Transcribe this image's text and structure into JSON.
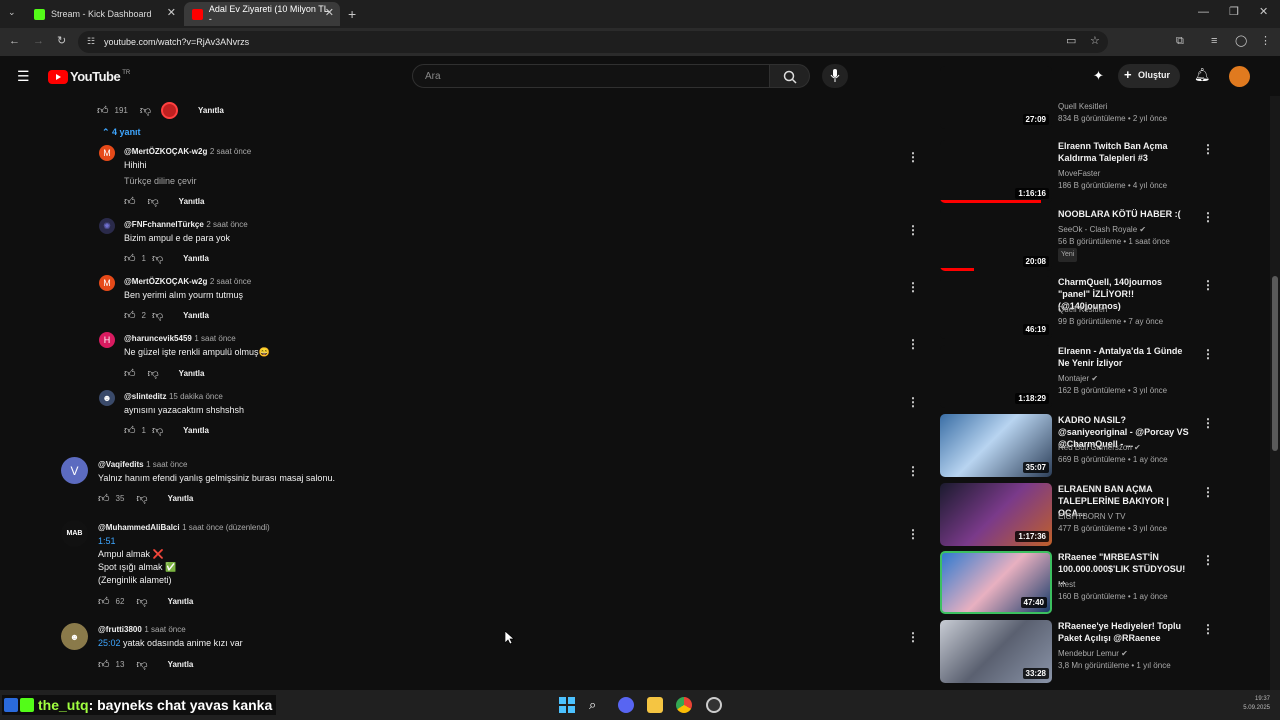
{
  "browser": {
    "tabs": [
      {
        "title": "Stream - Kick Dashboard"
      },
      {
        "title": "Adal Ev Ziyareti (10 Milyon TL -"
      }
    ],
    "url": "youtube.com/watch?v=RjAv3ANvrzs"
  },
  "youtube": {
    "logo": "YouTube",
    "country": "TR",
    "search_placeholder": "Ara",
    "create_label": "Oluştur"
  },
  "comments": {
    "top": {
      "likes": "191",
      "reply_label": "Yanıtla",
      "replies_toggle": "4 yanıt"
    },
    "replies": [
      {
        "initial": "M",
        "author": "@MertÖZKOÇAK-w2g",
        "time": "2 saat önce",
        "lines": [
          "Hihihi",
          "Türkçe diline çevir"
        ],
        "likes": "",
        "reply": "Yanıtla"
      },
      {
        "initial": "",
        "author": "@FNFchannelTürkçe",
        "time": "2 saat önce",
        "lines": [
          "Bizim ampul e de para yok"
        ],
        "likes": "1",
        "reply": "Yanıtla"
      },
      {
        "initial": "M",
        "author": "@MertÖZKOÇAK-w2g",
        "time": "2 saat önce",
        "lines": [
          "Ben yerimi alım yourm tutmuş"
        ],
        "likes": "2",
        "reply": "Yanıtla"
      },
      {
        "initial": "H",
        "author": "@haruncevik5459",
        "time": "1 saat önce",
        "lines": [
          "Ne güzel işte renkli ampulü olmuş😄"
        ],
        "likes": "",
        "reply": "Yanıtla"
      },
      {
        "initial": "",
        "author": "@slinteditz",
        "time": "15 dakika önce",
        "lines": [
          "aynısını yazacaktım shshshsh"
        ],
        "likes": "1",
        "reply": "Yanıtla"
      }
    ],
    "main": [
      {
        "initial": "V",
        "author": "@Vaqifedits",
        "time": "1 saat önce",
        "lines": [
          "Yalnız hanım efendi yanlış gelmişsiniz burası masaj salonu."
        ],
        "likes": "35",
        "reply": "Yanıtla"
      },
      {
        "initial": "MAB",
        "author": "@MuhammedAliBalci",
        "time": "1 saat önce (düzenlendi)",
        "ts": "1:51",
        "lines": [
          "Ampul almak ❌",
          "Spot ışığı almak ✅",
          "(Zenginlik alameti)"
        ],
        "likes": "62",
        "reply": "Yanıtla"
      },
      {
        "initial": "",
        "author": "@frutti3800",
        "time": "1 saat önce",
        "ts": "25:02",
        "lines": [
          "yatak odasında anime kızı var"
        ],
        "likes": "13",
        "reply": "Yanıtla"
      }
    ]
  },
  "sidebar": [
    {
      "title": "",
      "channel": "Quell Kesitleri",
      "meta": "834 B görüntüleme • 2 yıl önce",
      "duration": "27:09",
      "badge": ""
    },
    {
      "title": "Elraenn Twitch Ban Açma Kaldırma Talepleri #3",
      "channel": "MoveFaster",
      "meta": "186 B görüntüleme • 4 yıl önce",
      "duration": "1:16:16",
      "badge": "",
      "progress": "0.9"
    },
    {
      "title": "NOOBLARA KÖTÜ HABER :(",
      "channel": "SeeOk - Clash Royale",
      "meta": "56 B görüntüleme • 1 saat önce",
      "duration": "20:08",
      "badge": "Yeni",
      "progress": "0.3"
    },
    {
      "title": "CharmQuell, 140journos \"panel\" İZLİYOR!! (@140journos)",
      "channel": "Quell Kesitleri",
      "meta": "99 B görüntüleme • 7 ay önce",
      "duration": "46:19",
      "badge": ""
    },
    {
      "title": "Elraenn - Antalya'da 1 Günde Ne Yenir İzliyor",
      "channel": "Montajer",
      "meta": "162 B görüntüleme • 3 yıl önce",
      "duration": "1:18:29",
      "badge": ""
    },
    {
      "title": "KADRO NASIL? @saniyeoriginal - @Porcay VS @CharmQuell - ...",
      "channel": "Red Bull Gamerszon",
      "meta": "669 B görüntüleme • 1 ay önce",
      "duration": "35:07",
      "badge": ""
    },
    {
      "title": "ELRAENN BAN AÇMA TALEPLERİNE BAKIYOR | OCA...",
      "channel": "EIGHTBORN V TV",
      "meta": "477 B görüntüleme • 3 yıl önce",
      "duration": "1:17:36",
      "badge": ""
    },
    {
      "title": "RRaenee \"MRBEAST'İN 100.000.000$'LIK STÜDYOSU! ...",
      "channel": "Mest",
      "meta": "160 B görüntüleme • 1 ay önce",
      "duration": "47:40",
      "badge": ""
    },
    {
      "title": "RRaenee'ye Hediyeler! Toplu Paket Açılışı @RRaenee",
      "channel": "Mendebur Lemur",
      "meta": "3,8 Mn görüntüleme • 1 yıl önce",
      "duration": "33:28",
      "badge": ""
    }
  ],
  "overlay": {
    "chat_user": "the_utq",
    "chat_msg": ": bayneks chat yavas kanka"
  },
  "taskbar": {
    "time": "19:37",
    "date": "5.09.2025"
  }
}
